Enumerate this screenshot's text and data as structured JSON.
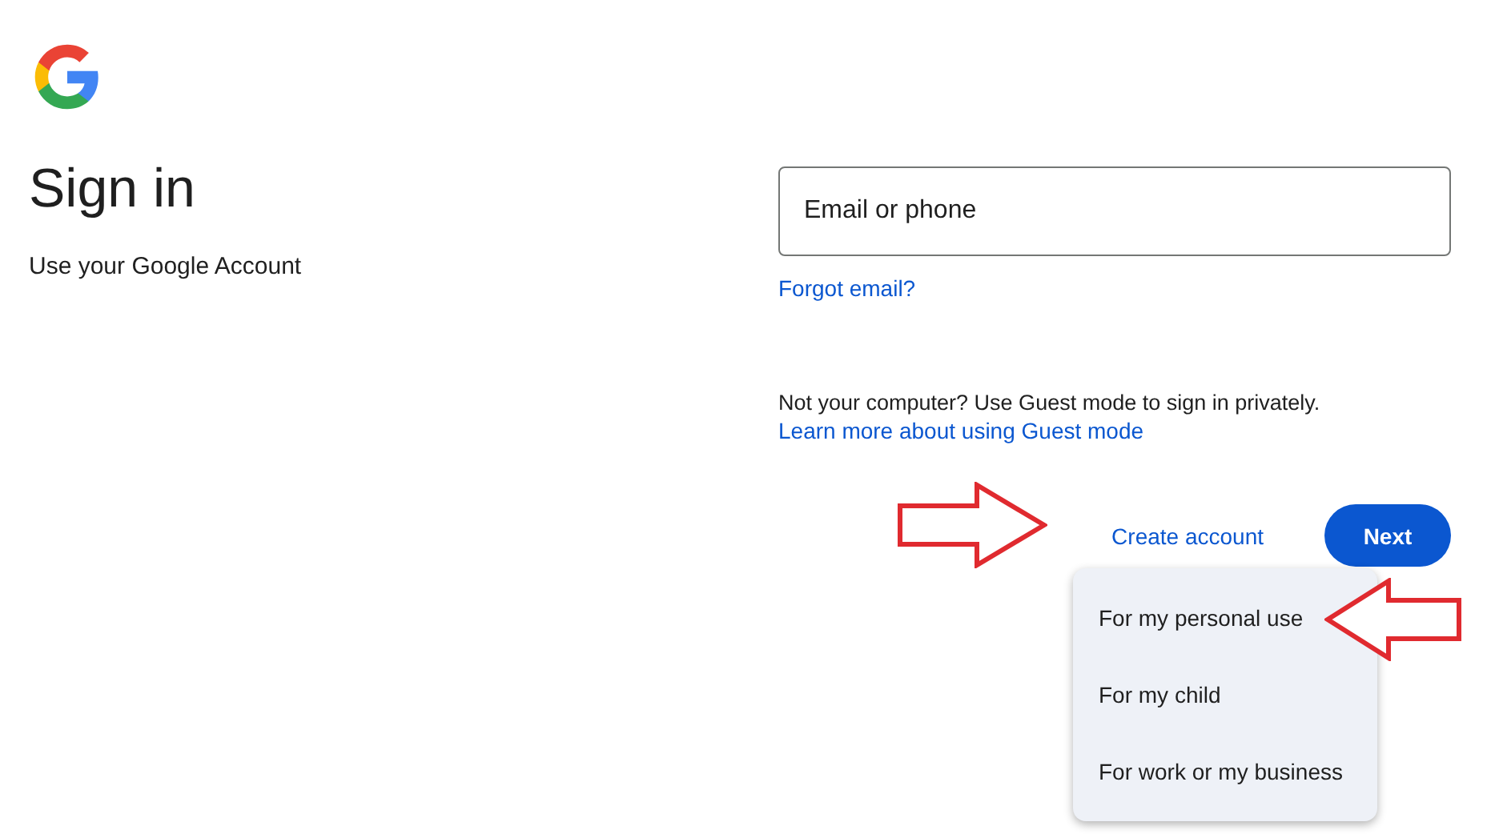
{
  "header": {
    "title": "Sign in",
    "subtitle": "Use your Google Account"
  },
  "email_field": {
    "placeholder": "Email or phone"
  },
  "forgot_link": "Forgot email?",
  "guest_notice": {
    "text": "Not your computer? Use Guest mode to sign in privately.",
    "link": "Learn more about using Guest mode"
  },
  "create_account": {
    "label": "Create account",
    "expanded": true
  },
  "next_button": "Next",
  "menu": [
    {
      "label": "For my personal use"
    },
    {
      "label": "For my child"
    },
    {
      "label": "For work or my business"
    }
  ]
}
